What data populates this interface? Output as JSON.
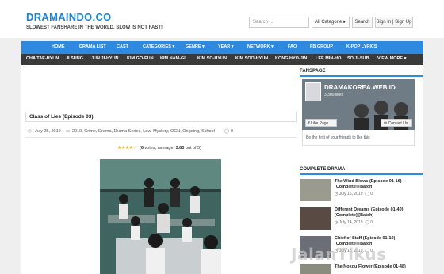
{
  "site": {
    "logo": "DRAMAINDO.CO",
    "tagline": "SLOWEST FANSHARE IN THE WORLD, SLOW IS NOT FAST!"
  },
  "header": {
    "search_placeholder": "Search ...",
    "category_select": "All Categories",
    "search_button": "Search",
    "signin_button": "Sign In | Sign Up"
  },
  "nav_main": [
    "HOME",
    "DRAMA LIST",
    "CAST",
    "CATEGORIES ▾",
    "GENRE ▾",
    "YEAR ▾",
    "NETWORK ▾",
    "FAQ",
    "FB GROUP",
    "K-POP LYRICS"
  ],
  "nav_cast": [
    "CHA TAE-HYUN",
    "JI SUNG",
    "JUN JI-HYUN",
    "KIM GO-EUN",
    "KIM NAM-GIL",
    "KIM SO-HYUN",
    "KIM SOO-HYUN",
    "KONG HYO-JIN",
    "LEE MIN-HO",
    "SO JI-SUB",
    "VIEW MORE ▾"
  ],
  "post": {
    "title": "Class of Lies (Episode 03)",
    "date": "July 25, 2019",
    "categories": "2019, Crime, Drama, Drama Series, Law, Mystery, OCN, Ongoing, School",
    "comments": "0",
    "rating_votes": "6",
    "rating_text_pre": "(",
    "rating_text_mid": " votes, average: ",
    "rating_average": "3.83",
    "rating_text_post": " out of 5)"
  },
  "sidebar": {
    "fanspage_heading": "FANSPAGE",
    "fb_page_name": "DRAMAKOREA.WEB.ID",
    "fb_likes": "3,309 likes",
    "fb_like_button": "Like Page",
    "fb_contact_button": "Contact Us",
    "fb_footer": "Be the first of your friends to like this",
    "complete_heading": "COMPLETE DRAMA",
    "dramas": [
      {
        "title": "The Wind Blows (Episode 01-16) [Complete] [Batch]",
        "date": "July 16, 2019",
        "comments": "0"
      },
      {
        "title": "Different Dreams (Episode 01-40) [Complete] [Batch]",
        "date": "July 14, 2019",
        "comments": "0"
      },
      {
        "title": "Chief of Staff (Episode 01-10) [Complete] [Batch]",
        "date": "July 13, 2019",
        "comments": "0"
      },
      {
        "title": "The Nokdu Flower (Episode 01-48)",
        "date": "",
        "comments": ""
      }
    ]
  },
  "watermark": "JalanTikus",
  "colors": {
    "accent": "#2d8ae0",
    "logo": "#1b85d6",
    "nav_dark": "#3a3a3a",
    "star": "#f3b100"
  }
}
